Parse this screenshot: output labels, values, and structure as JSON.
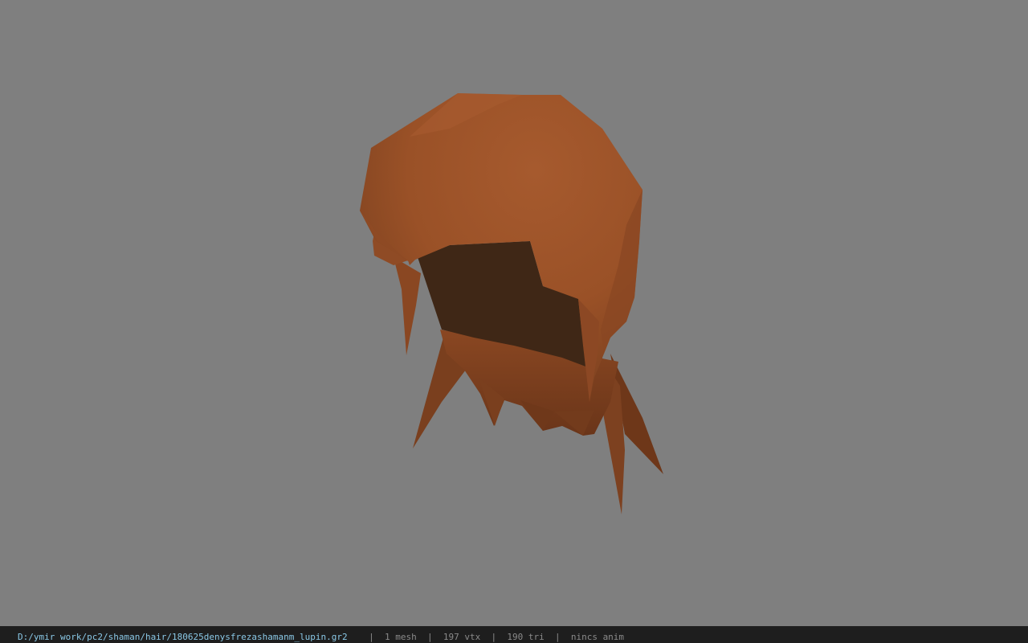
{
  "viewer": {
    "background_color": "#7f7f7f",
    "model_color": "#a2572b",
    "model_icon": "hair-mesh"
  },
  "status_bar": {
    "file_path": "D:/ymir work/pc2/shaman/hair/180625denysfrezashamanm_lupin.gr2",
    "separator": "|",
    "mesh_count": "1 mesh",
    "vertex_count": "197 vtx",
    "triangle_count": "190 tri",
    "anim_status": "nincs anim"
  }
}
